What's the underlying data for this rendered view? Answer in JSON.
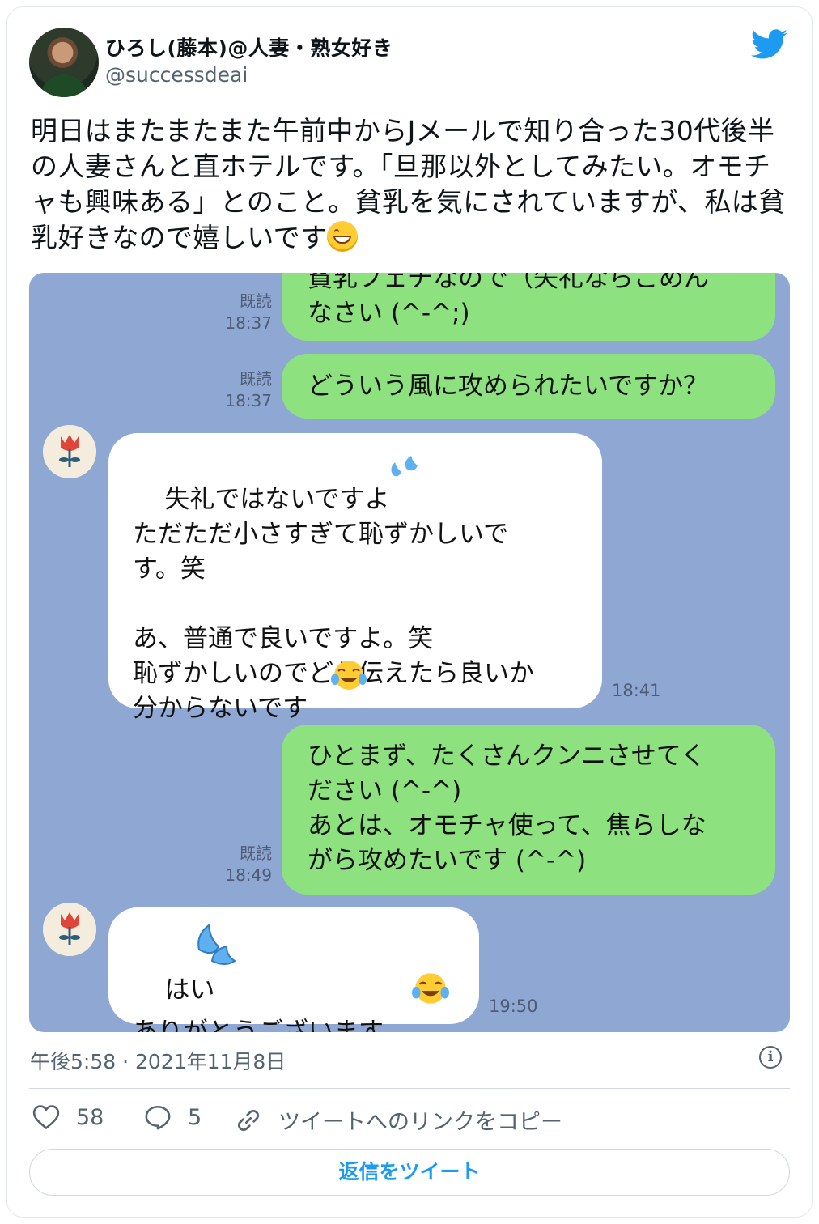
{
  "tweet": {
    "display_name": "ひろし(藤本)@人妻・熟女好き",
    "handle": "@successdeai",
    "text": "明日はまたまたまた午前中からJメールで知り合った30代後半の人妻さんと直ホテルです。「旦那以外としてみたい。オモチャも興味ある」とのこと。貧乳を気にされていますが、私は貧乳好きなので嬉しいです",
    "text_emoji": "grinning-face-emoji",
    "timestamp": "午後5:58 · 2021年11月8日"
  },
  "chat": {
    "messages": [
      {
        "side": "sent",
        "text": "貧乳フェチなので（失礼ならごめん\nなさい (^-^;)",
        "read": "既読",
        "time": "18:37"
      },
      {
        "side": "sent",
        "text": "どういう風に攻められたいですか？",
        "read": "既読",
        "time": "18:37"
      },
      {
        "side": "received",
        "text": "失礼ではないですよ\nただただ小さすぎて恥ずかしいで\nす。笑\n\nあ、普通で良いですよ。笑\n恥ずかしいのでどう伝えたら良いか\n分からないです",
        "time": "18:41"
      },
      {
        "side": "sent",
        "text": "ひとまず、たくさんクンニさせてく\nださい (^-^)\nあとは、オモチャ使って、焦らしな\nがら攻めたいです (^-^)",
        "read": "既読",
        "time": "18:49"
      },
      {
        "side": "received",
        "text": "はい\nありがとうございます",
        "time": "19:50"
      }
    ]
  },
  "actions": {
    "like_count": "58",
    "reply_count": "5",
    "copy_link_label": "ツイートへのリンクをコピー",
    "reply_button_label": "返信をツイート"
  },
  "colors": {
    "chat_background": "#8fa8d3",
    "sent_bubble": "#8de17f",
    "received_bubble": "#ffffff",
    "twitter_blue": "#1d9bf0"
  }
}
